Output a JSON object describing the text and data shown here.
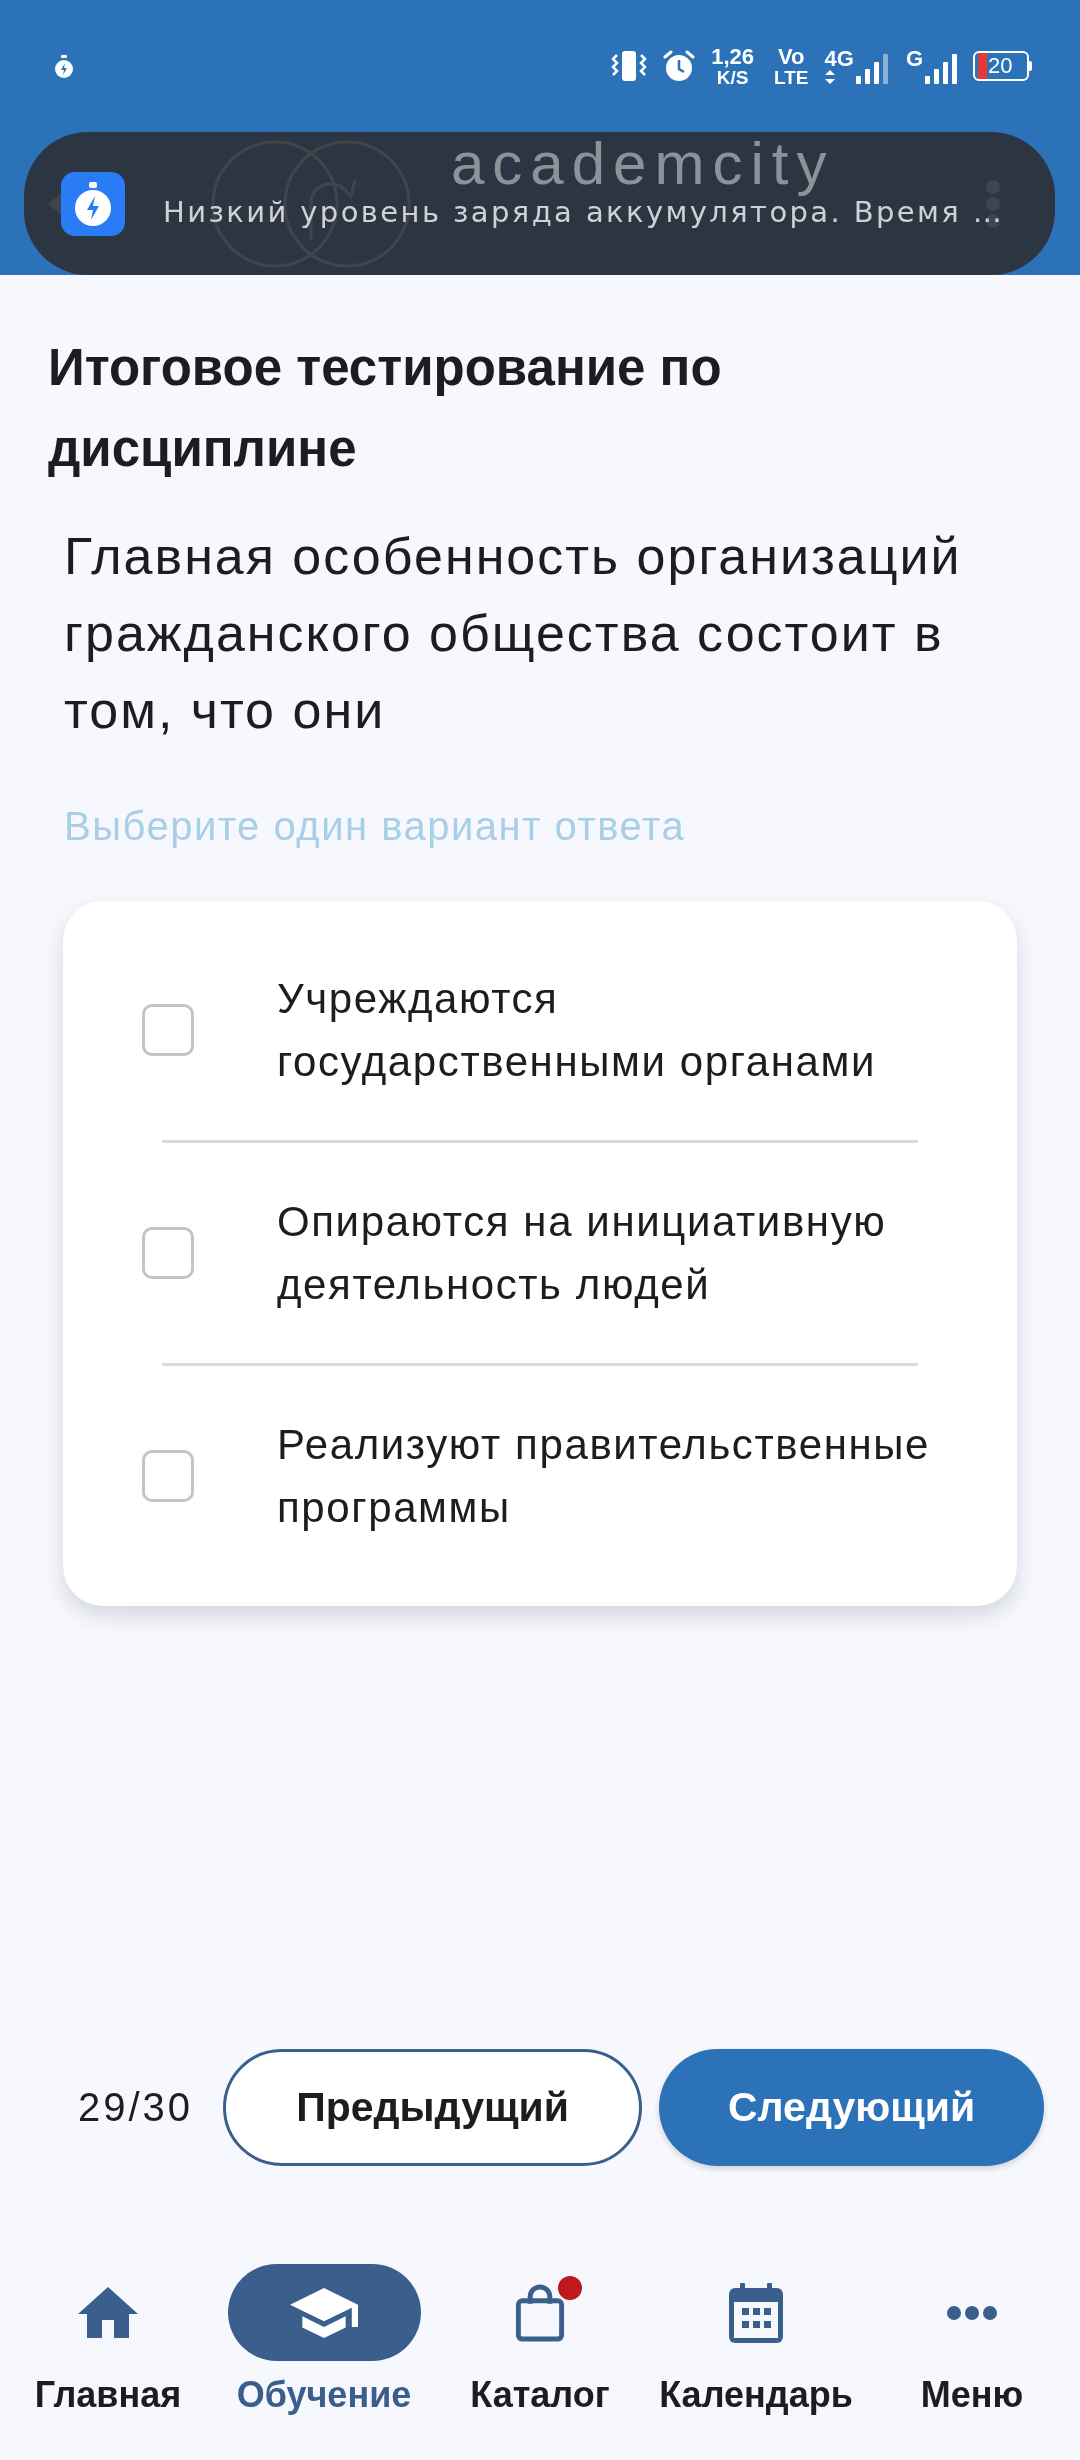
{
  "status_bar": {
    "speed": "1,26",
    "speed_unit": "K/S",
    "volte_top": "Vo",
    "volte_bottom": "LTE",
    "network_type": "4G",
    "network_type_2": "G",
    "battery": "20"
  },
  "header": {
    "logo_text": "academcity"
  },
  "notification": {
    "text": "Низкий уровень заряда аккумулятора. Время …"
  },
  "test": {
    "title": "Итоговое тестирование по дисциплине",
    "question": "Главная особенность организаций гражданского общества состоит в том, что они",
    "hint": "Выберите один вариант ответа",
    "options": [
      {
        "label": "Учреждаются государственными органами",
        "checked": false
      },
      {
        "label": "Опираются на инициативную деятельность людей",
        "checked": false
      },
      {
        "label": "Реализуют правительственные программы",
        "checked": false
      }
    ]
  },
  "pager": {
    "counter": "29/30",
    "previous": "Предыдущий",
    "next": "Следующий"
  },
  "bottom_nav": [
    {
      "label": "Главная",
      "selected": false,
      "badge": false
    },
    {
      "label": "Обучение",
      "selected": true,
      "badge": false
    },
    {
      "label": "Каталог",
      "selected": false,
      "badge": true
    },
    {
      "label": "Календарь",
      "selected": false,
      "badge": false
    },
    {
      "label": "Меню",
      "selected": false,
      "badge": false
    }
  ]
}
